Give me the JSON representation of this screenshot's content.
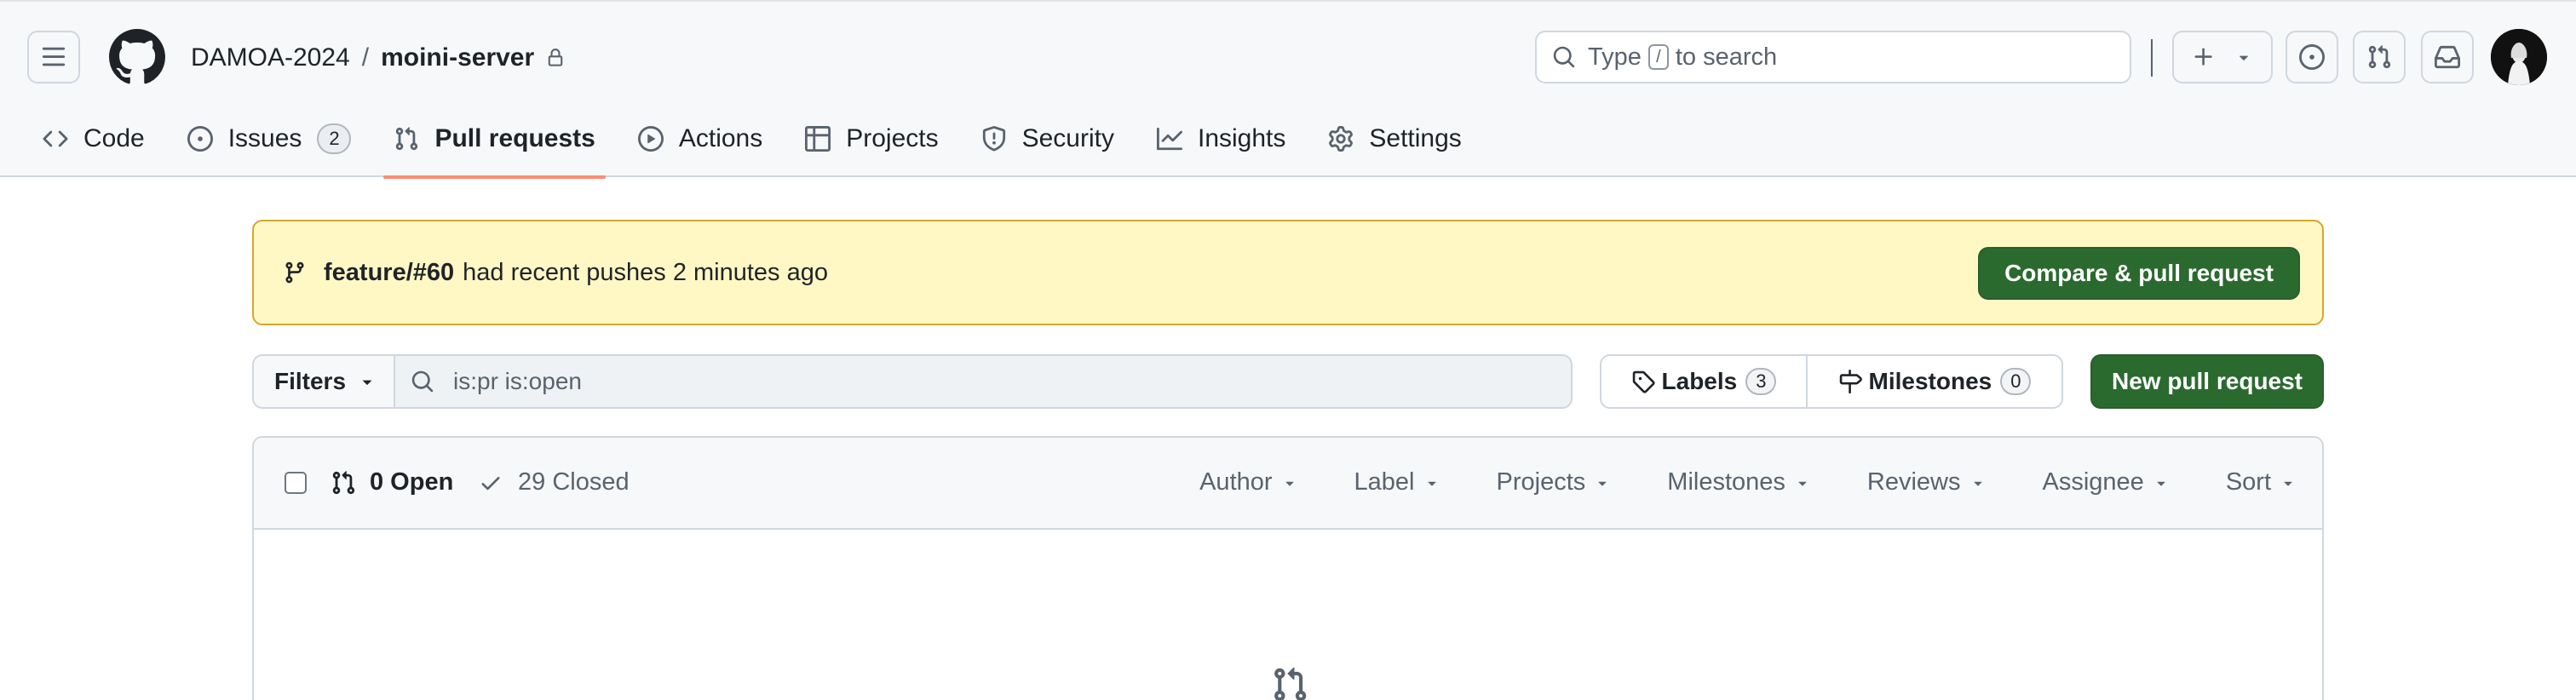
{
  "header": {
    "owner": "DAMOA-2024",
    "separator": "/",
    "repo": "moini-server",
    "search_prefix": "Type",
    "search_key": "/",
    "search_suffix": "to search"
  },
  "tabs": [
    {
      "label": "Code",
      "icon": "code-icon"
    },
    {
      "label": "Issues",
      "icon": "issue-opened-icon",
      "count": "2"
    },
    {
      "label": "Pull requests",
      "icon": "git-pull-request-icon",
      "active": true
    },
    {
      "label": "Actions",
      "icon": "play-icon"
    },
    {
      "label": "Projects",
      "icon": "table-icon"
    },
    {
      "label": "Security",
      "icon": "shield-icon"
    },
    {
      "label": "Insights",
      "icon": "graph-icon"
    },
    {
      "label": "Settings",
      "icon": "gear-icon"
    }
  ],
  "banner": {
    "branch": "feature/#60",
    "message": "had recent pushes 2 minutes ago",
    "button": "Compare & pull request"
  },
  "filters": {
    "button": "Filters",
    "query": "is:pr is:open"
  },
  "labels": {
    "label": "Labels",
    "count": "3"
  },
  "milestones": {
    "label": "Milestones",
    "count": "0"
  },
  "new_pr_button": "New pull request",
  "list": {
    "open_label": "0 Open",
    "closed_label": "29 Closed",
    "filters": [
      "Author",
      "Label",
      "Projects",
      "Milestones",
      "Reviews",
      "Assignee",
      "Sort"
    ]
  },
  "colors": {
    "primary_button": "#2b6a2f",
    "banner_bg": "#fff8c5",
    "active_tab_underline": "#fd8c73"
  }
}
